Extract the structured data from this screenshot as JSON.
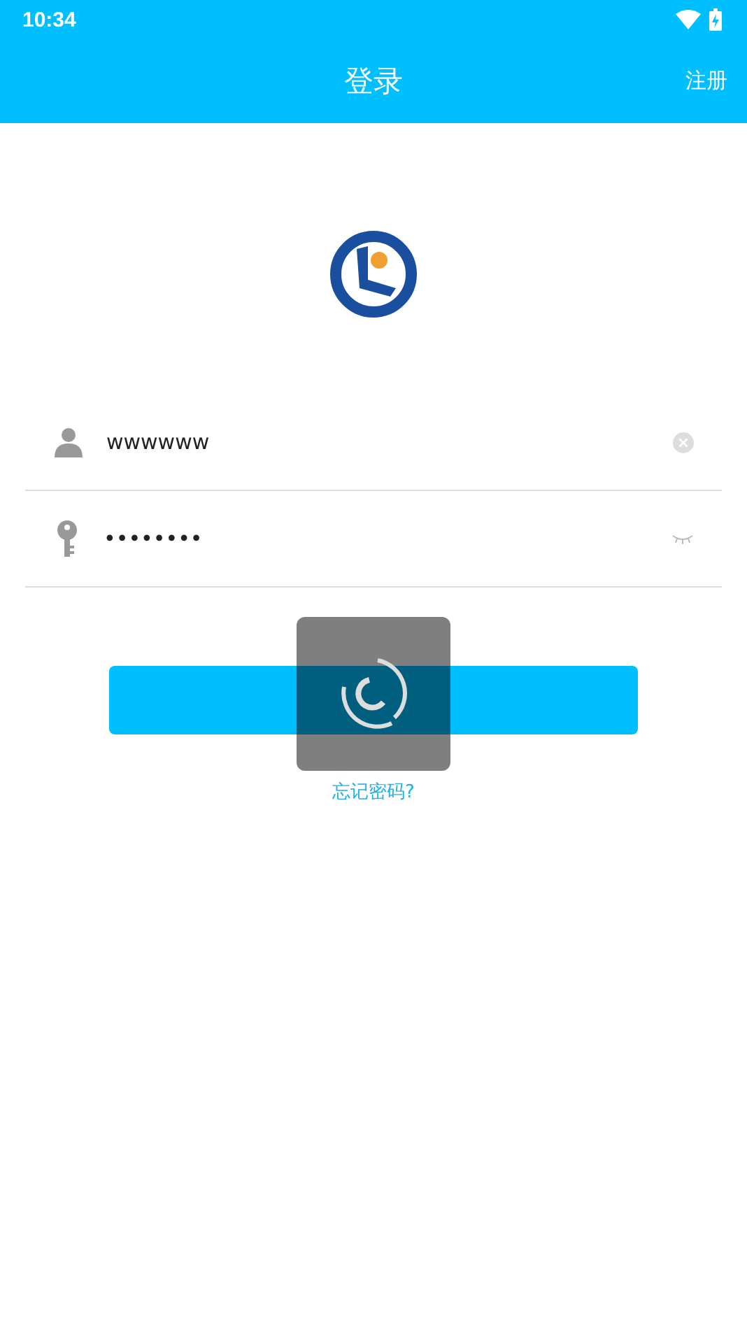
{
  "status_bar": {
    "time": "10:34"
  },
  "app_bar": {
    "title": "登录",
    "action": "注册"
  },
  "username": {
    "value": "wwwwww"
  },
  "password": {
    "value": "••••••••",
    "visible": false
  },
  "forgot_link": "忘记密码?",
  "loading": true
}
